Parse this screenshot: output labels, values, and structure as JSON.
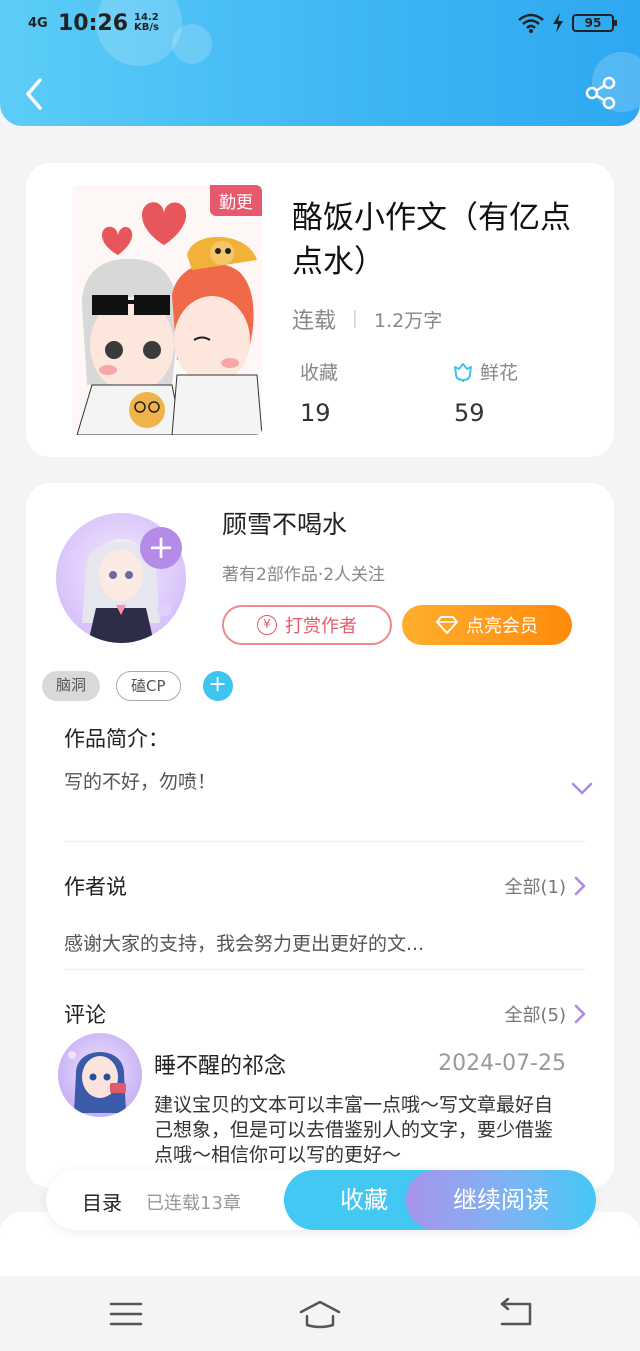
{
  "status_bar": {
    "network": "4G",
    "time": "10:26",
    "speed_value": "14.2",
    "speed_unit": "KB/s",
    "battery": "95"
  },
  "book": {
    "badge": "勤更",
    "title": "酪饭小作文（有亿点点水）",
    "status": "连载",
    "word_count": "1.2万字",
    "favorites_label": "收藏",
    "favorites_count": "19",
    "flowers_label": "鲜花",
    "flowers_count": "59"
  },
  "author": {
    "name": "顾雪不喝水",
    "info": "著有2部作品·2人关注",
    "tip_label": "打赏作者",
    "tip_icon": "¥",
    "vip_label": "点亮会员"
  },
  "tags": [
    "脑洞",
    "磕CP"
  ],
  "intro": {
    "title": "作品简介：",
    "text": "写的不好，勿喷！"
  },
  "author_says": {
    "title": "作者说",
    "more": "全部(1)",
    "text": "感谢大家的支持，我会努力更出更好的文..."
  },
  "comments": {
    "title": "评论",
    "more": "全部(5)",
    "first": {
      "user": "睡不醒的祁念",
      "date": "2024-07-25",
      "text": "建议宝贝的文本可以丰富一点哦～写文章最好自己想象，但是可以去借鉴别人的文字，要少借鉴点哦～相信你可以写的更好～"
    }
  },
  "bottom_bar": {
    "toc_label": "目录",
    "chapters": "已连载13章",
    "favorite_label": "收藏",
    "read_label": "继续阅读"
  },
  "colors": {
    "header_blue": "#3db4f4",
    "badge_red": "#e65a6e",
    "vip_orange": "#ff9a1a",
    "accent_purple": "#b48ce8"
  }
}
